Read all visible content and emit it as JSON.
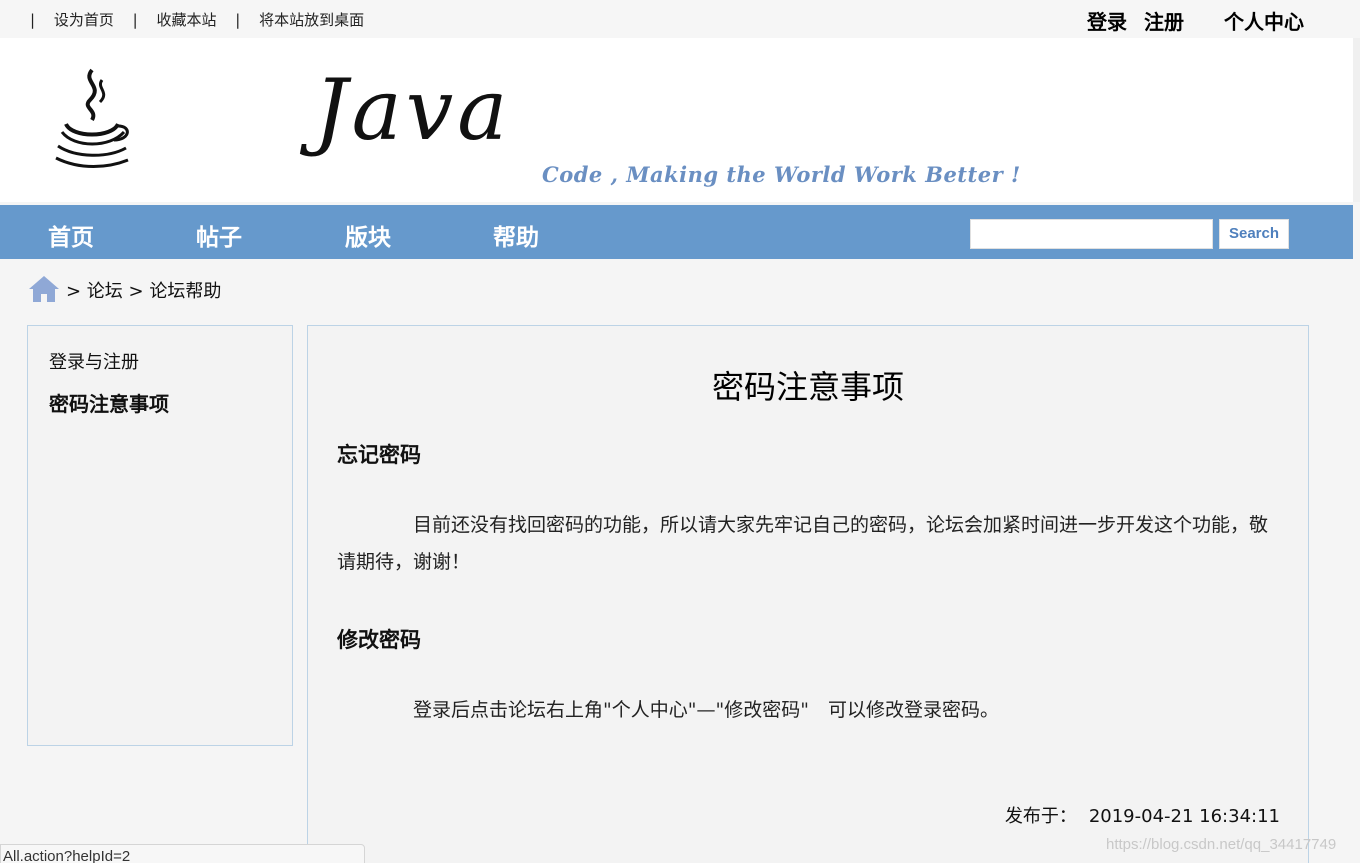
{
  "topbar": {
    "links": [
      "设为首页",
      "收藏本站",
      "将本站放到桌面"
    ],
    "separator": "|",
    "login": "登录",
    "register": "注册",
    "profile": "个人中心"
  },
  "banner": {
    "logo_text": "Java",
    "slogan": "Code , Making the World Work Better !"
  },
  "nav": {
    "items": [
      "首页",
      "帖子",
      "版块",
      "帮助"
    ],
    "search_button": "Search",
    "search_value": ""
  },
  "breadcrumb": {
    "text": "> 论坛 > 论坛帮助"
  },
  "sidebar": {
    "items": [
      "登录与注册",
      "密码注意事项"
    ]
  },
  "article": {
    "title": "密码注意事项",
    "sections": [
      {
        "heading": "忘记密码",
        "body": "目前还没有找回密码的功能，所以请大家先牢记自己的密码，论坛会加紧时间进一步开发这个功能，敬请期待，谢谢！"
      },
      {
        "heading": "修改密码",
        "body": "登录后点击论坛右上角\"个人中心\"—\"修改密码\"　可以修改登录密码。"
      }
    ],
    "published_label": "发布于：",
    "published_date": "2019-04-21 16:34:11"
  },
  "watermark": "https://blog.csdn.net/qq_34417749",
  "statusbar": "All.action?helpId=2"
}
